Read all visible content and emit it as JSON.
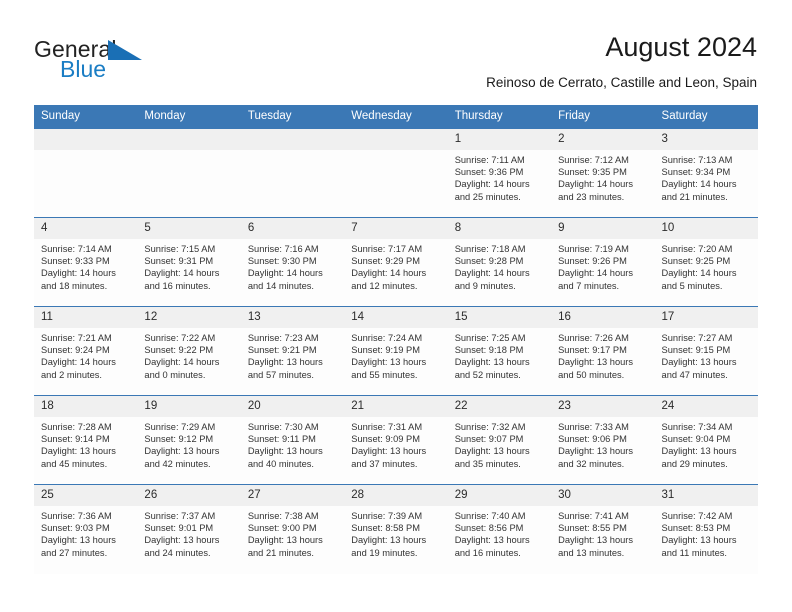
{
  "brand": {
    "name_part1": "General",
    "name_part2": "Blue",
    "triangle_icon": "triangle-icon",
    "color_dark": "#222222",
    "color_blue": "#1a7dc4"
  },
  "header": {
    "title": "August 2024",
    "subtitle": "Reinoso de Cerrato, Castille and Leon, Spain"
  },
  "calendar": {
    "header_bg": "#3b78b5",
    "daynum_bg": "#f0f0f0",
    "weekdays": [
      "Sunday",
      "Monday",
      "Tuesday",
      "Wednesday",
      "Thursday",
      "Friday",
      "Saturday"
    ],
    "weeks": [
      [
        {
          "day": "",
          "sunrise": "",
          "sunset": "",
          "daylight1": "",
          "daylight2": ""
        },
        {
          "day": "",
          "sunrise": "",
          "sunset": "",
          "daylight1": "",
          "daylight2": ""
        },
        {
          "day": "",
          "sunrise": "",
          "sunset": "",
          "daylight1": "",
          "daylight2": ""
        },
        {
          "day": "",
          "sunrise": "",
          "sunset": "",
          "daylight1": "",
          "daylight2": ""
        },
        {
          "day": "1",
          "sunrise": "Sunrise: 7:11 AM",
          "sunset": "Sunset: 9:36 PM",
          "daylight1": "Daylight: 14 hours",
          "daylight2": "and 25 minutes."
        },
        {
          "day": "2",
          "sunrise": "Sunrise: 7:12 AM",
          "sunset": "Sunset: 9:35 PM",
          "daylight1": "Daylight: 14 hours",
          "daylight2": "and 23 minutes."
        },
        {
          "day": "3",
          "sunrise": "Sunrise: 7:13 AM",
          "sunset": "Sunset: 9:34 PM",
          "daylight1": "Daylight: 14 hours",
          "daylight2": "and 21 minutes."
        }
      ],
      [
        {
          "day": "4",
          "sunrise": "Sunrise: 7:14 AM",
          "sunset": "Sunset: 9:33 PM",
          "daylight1": "Daylight: 14 hours",
          "daylight2": "and 18 minutes."
        },
        {
          "day": "5",
          "sunrise": "Sunrise: 7:15 AM",
          "sunset": "Sunset: 9:31 PM",
          "daylight1": "Daylight: 14 hours",
          "daylight2": "and 16 minutes."
        },
        {
          "day": "6",
          "sunrise": "Sunrise: 7:16 AM",
          "sunset": "Sunset: 9:30 PM",
          "daylight1": "Daylight: 14 hours",
          "daylight2": "and 14 minutes."
        },
        {
          "day": "7",
          "sunrise": "Sunrise: 7:17 AM",
          "sunset": "Sunset: 9:29 PM",
          "daylight1": "Daylight: 14 hours",
          "daylight2": "and 12 minutes."
        },
        {
          "day": "8",
          "sunrise": "Sunrise: 7:18 AM",
          "sunset": "Sunset: 9:28 PM",
          "daylight1": "Daylight: 14 hours",
          "daylight2": "and 9 minutes."
        },
        {
          "day": "9",
          "sunrise": "Sunrise: 7:19 AM",
          "sunset": "Sunset: 9:26 PM",
          "daylight1": "Daylight: 14 hours",
          "daylight2": "and 7 minutes."
        },
        {
          "day": "10",
          "sunrise": "Sunrise: 7:20 AM",
          "sunset": "Sunset: 9:25 PM",
          "daylight1": "Daylight: 14 hours",
          "daylight2": "and 5 minutes."
        }
      ],
      [
        {
          "day": "11",
          "sunrise": "Sunrise: 7:21 AM",
          "sunset": "Sunset: 9:24 PM",
          "daylight1": "Daylight: 14 hours",
          "daylight2": "and 2 minutes."
        },
        {
          "day": "12",
          "sunrise": "Sunrise: 7:22 AM",
          "sunset": "Sunset: 9:22 PM",
          "daylight1": "Daylight: 14 hours",
          "daylight2": "and 0 minutes."
        },
        {
          "day": "13",
          "sunrise": "Sunrise: 7:23 AM",
          "sunset": "Sunset: 9:21 PM",
          "daylight1": "Daylight: 13 hours",
          "daylight2": "and 57 minutes."
        },
        {
          "day": "14",
          "sunrise": "Sunrise: 7:24 AM",
          "sunset": "Sunset: 9:19 PM",
          "daylight1": "Daylight: 13 hours",
          "daylight2": "and 55 minutes."
        },
        {
          "day": "15",
          "sunrise": "Sunrise: 7:25 AM",
          "sunset": "Sunset: 9:18 PM",
          "daylight1": "Daylight: 13 hours",
          "daylight2": "and 52 minutes."
        },
        {
          "day": "16",
          "sunrise": "Sunrise: 7:26 AM",
          "sunset": "Sunset: 9:17 PM",
          "daylight1": "Daylight: 13 hours",
          "daylight2": "and 50 minutes."
        },
        {
          "day": "17",
          "sunrise": "Sunrise: 7:27 AM",
          "sunset": "Sunset: 9:15 PM",
          "daylight1": "Daylight: 13 hours",
          "daylight2": "and 47 minutes."
        }
      ],
      [
        {
          "day": "18",
          "sunrise": "Sunrise: 7:28 AM",
          "sunset": "Sunset: 9:14 PM",
          "daylight1": "Daylight: 13 hours",
          "daylight2": "and 45 minutes."
        },
        {
          "day": "19",
          "sunrise": "Sunrise: 7:29 AM",
          "sunset": "Sunset: 9:12 PM",
          "daylight1": "Daylight: 13 hours",
          "daylight2": "and 42 minutes."
        },
        {
          "day": "20",
          "sunrise": "Sunrise: 7:30 AM",
          "sunset": "Sunset: 9:11 PM",
          "daylight1": "Daylight: 13 hours",
          "daylight2": "and 40 minutes."
        },
        {
          "day": "21",
          "sunrise": "Sunrise: 7:31 AM",
          "sunset": "Sunset: 9:09 PM",
          "daylight1": "Daylight: 13 hours",
          "daylight2": "and 37 minutes."
        },
        {
          "day": "22",
          "sunrise": "Sunrise: 7:32 AM",
          "sunset": "Sunset: 9:07 PM",
          "daylight1": "Daylight: 13 hours",
          "daylight2": "and 35 minutes."
        },
        {
          "day": "23",
          "sunrise": "Sunrise: 7:33 AM",
          "sunset": "Sunset: 9:06 PM",
          "daylight1": "Daylight: 13 hours",
          "daylight2": "and 32 minutes."
        },
        {
          "day": "24",
          "sunrise": "Sunrise: 7:34 AM",
          "sunset": "Sunset: 9:04 PM",
          "daylight1": "Daylight: 13 hours",
          "daylight2": "and 29 minutes."
        }
      ],
      [
        {
          "day": "25",
          "sunrise": "Sunrise: 7:36 AM",
          "sunset": "Sunset: 9:03 PM",
          "daylight1": "Daylight: 13 hours",
          "daylight2": "and 27 minutes."
        },
        {
          "day": "26",
          "sunrise": "Sunrise: 7:37 AM",
          "sunset": "Sunset: 9:01 PM",
          "daylight1": "Daylight: 13 hours",
          "daylight2": "and 24 minutes."
        },
        {
          "day": "27",
          "sunrise": "Sunrise: 7:38 AM",
          "sunset": "Sunset: 9:00 PM",
          "daylight1": "Daylight: 13 hours",
          "daylight2": "and 21 minutes."
        },
        {
          "day": "28",
          "sunrise": "Sunrise: 7:39 AM",
          "sunset": "Sunset: 8:58 PM",
          "daylight1": "Daylight: 13 hours",
          "daylight2": "and 19 minutes."
        },
        {
          "day": "29",
          "sunrise": "Sunrise: 7:40 AM",
          "sunset": "Sunset: 8:56 PM",
          "daylight1": "Daylight: 13 hours",
          "daylight2": "and 16 minutes."
        },
        {
          "day": "30",
          "sunrise": "Sunrise: 7:41 AM",
          "sunset": "Sunset: 8:55 PM",
          "daylight1": "Daylight: 13 hours",
          "daylight2": "and 13 minutes."
        },
        {
          "day": "31",
          "sunrise": "Sunrise: 7:42 AM",
          "sunset": "Sunset: 8:53 PM",
          "daylight1": "Daylight: 13 hours",
          "daylight2": "and 11 minutes."
        }
      ]
    ]
  }
}
